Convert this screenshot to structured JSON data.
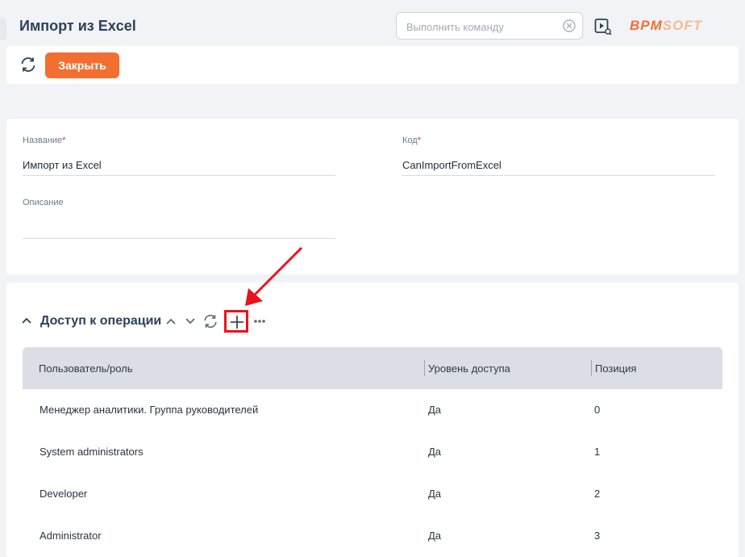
{
  "header": {
    "title": "Импорт из Excel",
    "command_placeholder": "Выполнить команду",
    "logo_part1": "BPM",
    "logo_part2": "SOFT"
  },
  "toolbar": {
    "close_label": "Закрыть"
  },
  "form": {
    "name_label": "Название",
    "name_value": "Импорт из Excel",
    "code_label": "Код",
    "code_value": "CanImportFromExcel",
    "description_label": "Описание",
    "description_value": "",
    "required_mark": "*"
  },
  "detail": {
    "title": "Доступ к операции",
    "columns": [
      "Пользователь/роль",
      "Уровень доступа",
      "Позиция"
    ],
    "rows": [
      {
        "user": "Менеджер аналитики. Группа руководителей",
        "access": "Да",
        "position": "0"
      },
      {
        "user": "System administrators",
        "access": "Да",
        "position": "1"
      },
      {
        "user": "Developer",
        "access": "Да",
        "position": "2"
      },
      {
        "user": "Administrator",
        "access": "Да",
        "position": "3"
      }
    ]
  },
  "colors": {
    "accent": "#f36f31",
    "highlight": "#e8141b",
    "header_bg": "#dcdee5"
  }
}
